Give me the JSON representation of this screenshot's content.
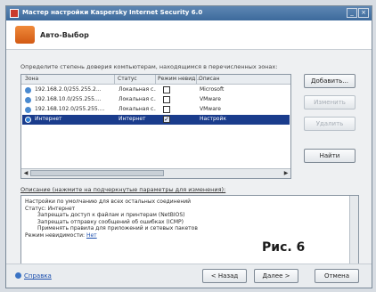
{
  "window": {
    "title": "Мастер настройки Kaspersky Internet Security 6.0",
    "header_title": "Авто-Выбор"
  },
  "description": "Определите степень доверия компьютерам, находящимся в перечисленных зонах:",
  "grid": {
    "columns": [
      "Зона",
      "Статус",
      "Режим невид...",
      "Описан"
    ],
    "rows": [
      {
        "zone": "192.168.2.0/255.255.2...",
        "status": "Локальная с...",
        "stealth": false,
        "desc": "Microsoft",
        "selected": false
      },
      {
        "zone": "192.168.10.0/255.255....",
        "status": "Локальная с...",
        "stealth": false,
        "desc": "VMware",
        "selected": false
      },
      {
        "zone": "192.168.102.0/255.255....",
        "status": "Локальная с...",
        "stealth": false,
        "desc": "VMware",
        "selected": false
      },
      {
        "zone": "Интернет",
        "status": "Интернет",
        "stealth": true,
        "desc": "Настройки",
        "selected": true
      }
    ]
  },
  "side_buttons": {
    "add": "Добавить...",
    "change": "Изменить",
    "delete": "Удалить",
    "find": "Найти"
  },
  "info_label": "Описание (нажмите на подчеркнутые параметры для изменения):",
  "info_lines": [
    {
      "text": "Настройки по умолчанию для всех остальных соединений",
      "level": 1
    },
    {
      "text": "Статус: Интернет",
      "level": 1
    },
    {
      "text": "Запрещать доступ к файлам и принтерам (NetBIOS)",
      "level": 2
    },
    {
      "text": "Запрещать отправку сообщений об ошибках (ICMP)",
      "level": 2
    },
    {
      "text": "Применять правила для приложений и сетевых пакетов",
      "level": 2
    }
  ],
  "info_stealth_prefix": "Режим невидимости: ",
  "info_stealth_link": "Нет",
  "figure_label": "Рис. 6",
  "footer": {
    "help": "Справка",
    "back": "< Назад",
    "next": "Далее >",
    "cancel": "Отмена"
  }
}
